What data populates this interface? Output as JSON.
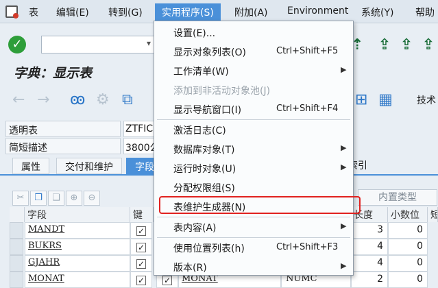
{
  "menubar": {
    "items": [
      {
        "label": "表"
      },
      {
        "label": "编辑(E)"
      },
      {
        "label": "转到(G)"
      },
      {
        "label": "实用程序(S)"
      },
      {
        "label": "附加(A)"
      },
      {
        "label": "Environment"
      },
      {
        "label": "系统(Y)"
      },
      {
        "label": "帮助"
      }
    ]
  },
  "title": "字典：显示表",
  "toolbar2": {
    "tech_label": "技术"
  },
  "form": {
    "table_label": "透明表",
    "table_value": "ZTFIC",
    "desc_label": "简短描述",
    "desc_value": "3800公"
  },
  "tabs": [
    "属性",
    "交付和维护",
    "字段",
    "索引"
  ],
  "table": {
    "type_button": "内置类型",
    "headers": {
      "field": "字段",
      "key": "键",
      "length": "长度",
      "decimals": "小数位",
      "partial": "短"
    },
    "rows": [
      {
        "field": "MANDT",
        "length": "3",
        "decimals": "0"
      },
      {
        "field": "BUKRS",
        "length": "4",
        "decimals": "0"
      },
      {
        "field": "GJAHR",
        "length": "4",
        "decimals": "0"
      },
      {
        "field": "MONAT",
        "length": "2",
        "decimals": "0",
        "domain": "MONAT",
        "type": "NUMC"
      }
    ]
  },
  "dropdown": {
    "items": [
      {
        "label": "设置(E)...",
        "shortcut": "",
        "submenu": false,
        "disabled": false
      },
      {
        "label": "显示对象列表(O)",
        "shortcut": "Ctrl+Shift+F5",
        "submenu": false,
        "disabled": false
      },
      {
        "label": "工作清单(W)",
        "shortcut": "",
        "submenu": true,
        "disabled": false
      },
      {
        "label": "添加到非活动对象池(J)",
        "shortcut": "",
        "submenu": false,
        "disabled": true
      },
      {
        "label": "显示导航窗口(I)",
        "shortcut": "Ctrl+Shift+F4",
        "submenu": false,
        "disabled": false
      },
      {
        "label": "激活日志(C)",
        "shortcut": "",
        "submenu": false,
        "disabled": false
      },
      {
        "label": "数据库对象(T)",
        "shortcut": "",
        "submenu": true,
        "disabled": false
      },
      {
        "label": "运行时对象(U)",
        "shortcut": "",
        "submenu": true,
        "disabled": false
      },
      {
        "label": "分配权限组(S)",
        "shortcut": "",
        "submenu": false,
        "disabled": false
      },
      {
        "label": "表维护生成器(N)",
        "shortcut": "",
        "submenu": false,
        "disabled": false
      },
      {
        "label": "表内容(A)",
        "shortcut": "",
        "submenu": true,
        "disabled": false
      },
      {
        "label": "使用位置列表(h)",
        "shortcut": "Ctrl+Shift+F3",
        "submenu": false,
        "disabled": false
      },
      {
        "label": "版本(R)",
        "shortcut": "",
        "submenu": true,
        "disabled": false
      }
    ],
    "highlighted": "表维护生成器(N)"
  },
  "colors": {
    "accent": "#4a90d9",
    "highlight": "#e1211f",
    "ok": "#2e9e3a"
  }
}
